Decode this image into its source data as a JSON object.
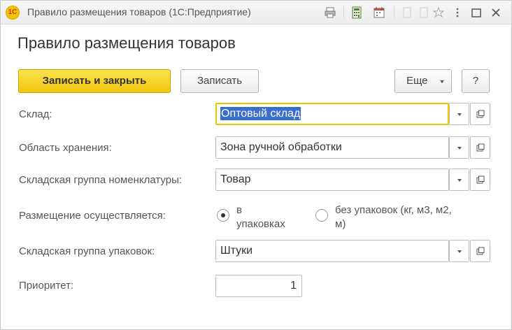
{
  "window": {
    "logo_text": "1С",
    "title": "Правило размещения товаров  (1С:Предприятие)"
  },
  "titlebar_icons": [
    "print-icon",
    "calculator-icon",
    "calendar-icon",
    "bookmark-icon",
    "close-icon"
  ],
  "form": {
    "title": "Правило размещения товаров"
  },
  "toolbar": {
    "save_close_label": "Записать и закрыть",
    "save_label": "Записать",
    "more_label": "Еще",
    "help_label": "?"
  },
  "fields": {
    "warehouse": {
      "label": "Склад:",
      "value": "Оптовый склад"
    },
    "storage_area": {
      "label": "Область хранения:",
      "value": "Зона ручной обработки"
    },
    "item_group": {
      "label": "Складская группа номенклатуры:",
      "value": "Товар"
    },
    "placement": {
      "label": "Размещение осуществляется:",
      "option1_line1": "в",
      "option1_line2": "упаковках",
      "option2_line1": "без упаковок (кг, м3, м2,",
      "option2_line2": "м)",
      "selected": "option1"
    },
    "package_group": {
      "label": "Складская группа упаковок:",
      "value": "Штуки"
    },
    "priority": {
      "label": "Приоритет:",
      "value": "1"
    }
  },
  "colors": {
    "primary_button": "#f1c510",
    "focus_border": "#eac500",
    "selection": "#3a6fd0"
  }
}
